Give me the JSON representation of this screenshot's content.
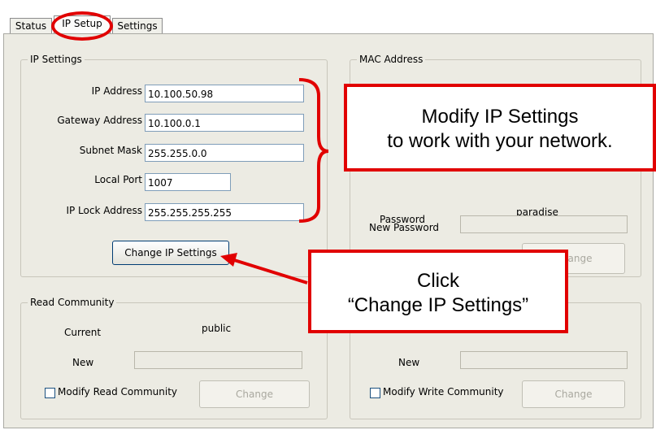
{
  "tabs": {
    "status": "Status",
    "ip_setup": "IP Setup",
    "settings": "Settings"
  },
  "ip_settings": {
    "legend": "IP Settings",
    "ip_address_label": "IP Address",
    "ip_address": "10.100.50.98",
    "gateway_label": "Gateway Address",
    "gateway": "10.100.0.1",
    "subnet_label": "Subnet Mask",
    "subnet": "255.255.0.0",
    "local_port_label": "Local Port",
    "local_port": "1007",
    "ip_lock_label": "IP Lock Address",
    "ip_lock": "255.255.255.255",
    "change_button": "Change IP Settings"
  },
  "mac_address": {
    "legend": "MAC Address",
    "password_label": "Password",
    "password_value": "paradise",
    "new_password_label": "New Password",
    "change_button": "Change"
  },
  "read_community": {
    "legend": "Read Community",
    "current_label": "Current",
    "current_value": "public",
    "new_label": "New",
    "modify_label": "Modify Read Community",
    "change_button": "Change"
  },
  "write_community": {
    "new_label": "New",
    "modify_label": "Modify Write Community",
    "change_button": "Change"
  },
  "callouts": {
    "ip_line1": "Modify IP Settings",
    "ip_line2": "to work with your network.",
    "click_line1": "Click",
    "click_line2": "“Change IP Settings”"
  },
  "colors": {
    "annotation_red": "#e10000",
    "panel_bg": "#ecebe3",
    "input_border": "#7f9db9"
  }
}
